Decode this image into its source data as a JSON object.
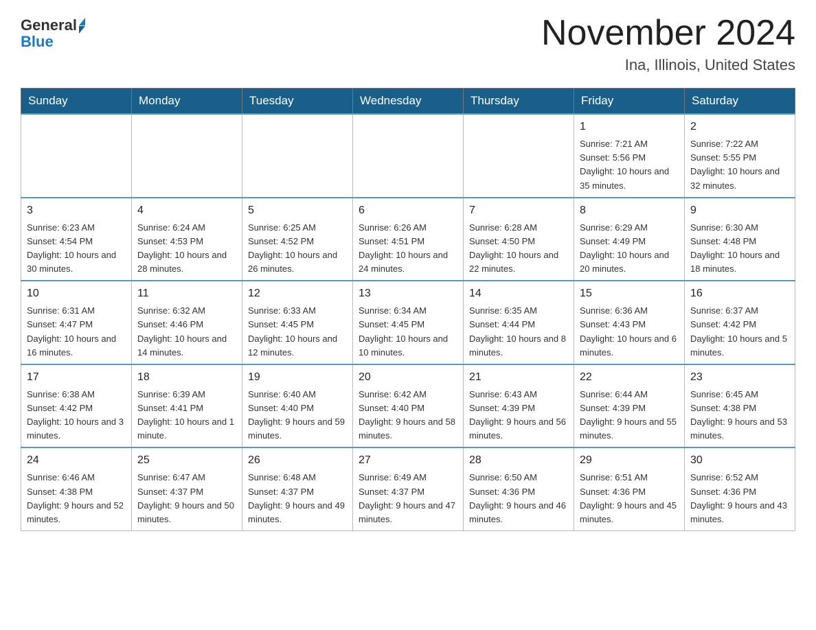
{
  "logo": {
    "general": "General",
    "blue": "Blue"
  },
  "title": "November 2024",
  "location": "Ina, Illinois, United States",
  "weekdays": [
    "Sunday",
    "Monday",
    "Tuesday",
    "Wednesday",
    "Thursday",
    "Friday",
    "Saturday"
  ],
  "weeks": [
    [
      {
        "day": "",
        "info": ""
      },
      {
        "day": "",
        "info": ""
      },
      {
        "day": "",
        "info": ""
      },
      {
        "day": "",
        "info": ""
      },
      {
        "day": "",
        "info": ""
      },
      {
        "day": "1",
        "info": "Sunrise: 7:21 AM\nSunset: 5:56 PM\nDaylight: 10 hours and 35 minutes."
      },
      {
        "day": "2",
        "info": "Sunrise: 7:22 AM\nSunset: 5:55 PM\nDaylight: 10 hours and 32 minutes."
      }
    ],
    [
      {
        "day": "3",
        "info": "Sunrise: 6:23 AM\nSunset: 4:54 PM\nDaylight: 10 hours and 30 minutes."
      },
      {
        "day": "4",
        "info": "Sunrise: 6:24 AM\nSunset: 4:53 PM\nDaylight: 10 hours and 28 minutes."
      },
      {
        "day": "5",
        "info": "Sunrise: 6:25 AM\nSunset: 4:52 PM\nDaylight: 10 hours and 26 minutes."
      },
      {
        "day": "6",
        "info": "Sunrise: 6:26 AM\nSunset: 4:51 PM\nDaylight: 10 hours and 24 minutes."
      },
      {
        "day": "7",
        "info": "Sunrise: 6:28 AM\nSunset: 4:50 PM\nDaylight: 10 hours and 22 minutes."
      },
      {
        "day": "8",
        "info": "Sunrise: 6:29 AM\nSunset: 4:49 PM\nDaylight: 10 hours and 20 minutes."
      },
      {
        "day": "9",
        "info": "Sunrise: 6:30 AM\nSunset: 4:48 PM\nDaylight: 10 hours and 18 minutes."
      }
    ],
    [
      {
        "day": "10",
        "info": "Sunrise: 6:31 AM\nSunset: 4:47 PM\nDaylight: 10 hours and 16 minutes."
      },
      {
        "day": "11",
        "info": "Sunrise: 6:32 AM\nSunset: 4:46 PM\nDaylight: 10 hours and 14 minutes."
      },
      {
        "day": "12",
        "info": "Sunrise: 6:33 AM\nSunset: 4:45 PM\nDaylight: 10 hours and 12 minutes."
      },
      {
        "day": "13",
        "info": "Sunrise: 6:34 AM\nSunset: 4:45 PM\nDaylight: 10 hours and 10 minutes."
      },
      {
        "day": "14",
        "info": "Sunrise: 6:35 AM\nSunset: 4:44 PM\nDaylight: 10 hours and 8 minutes."
      },
      {
        "day": "15",
        "info": "Sunrise: 6:36 AM\nSunset: 4:43 PM\nDaylight: 10 hours and 6 minutes."
      },
      {
        "day": "16",
        "info": "Sunrise: 6:37 AM\nSunset: 4:42 PM\nDaylight: 10 hours and 5 minutes."
      }
    ],
    [
      {
        "day": "17",
        "info": "Sunrise: 6:38 AM\nSunset: 4:42 PM\nDaylight: 10 hours and 3 minutes."
      },
      {
        "day": "18",
        "info": "Sunrise: 6:39 AM\nSunset: 4:41 PM\nDaylight: 10 hours and 1 minute."
      },
      {
        "day": "19",
        "info": "Sunrise: 6:40 AM\nSunset: 4:40 PM\nDaylight: 9 hours and 59 minutes."
      },
      {
        "day": "20",
        "info": "Sunrise: 6:42 AM\nSunset: 4:40 PM\nDaylight: 9 hours and 58 minutes."
      },
      {
        "day": "21",
        "info": "Sunrise: 6:43 AM\nSunset: 4:39 PM\nDaylight: 9 hours and 56 minutes."
      },
      {
        "day": "22",
        "info": "Sunrise: 6:44 AM\nSunset: 4:39 PM\nDaylight: 9 hours and 55 minutes."
      },
      {
        "day": "23",
        "info": "Sunrise: 6:45 AM\nSunset: 4:38 PM\nDaylight: 9 hours and 53 minutes."
      }
    ],
    [
      {
        "day": "24",
        "info": "Sunrise: 6:46 AM\nSunset: 4:38 PM\nDaylight: 9 hours and 52 minutes."
      },
      {
        "day": "25",
        "info": "Sunrise: 6:47 AM\nSunset: 4:37 PM\nDaylight: 9 hours and 50 minutes."
      },
      {
        "day": "26",
        "info": "Sunrise: 6:48 AM\nSunset: 4:37 PM\nDaylight: 9 hours and 49 minutes."
      },
      {
        "day": "27",
        "info": "Sunrise: 6:49 AM\nSunset: 4:37 PM\nDaylight: 9 hours and 47 minutes."
      },
      {
        "day": "28",
        "info": "Sunrise: 6:50 AM\nSunset: 4:36 PM\nDaylight: 9 hours and 46 minutes."
      },
      {
        "day": "29",
        "info": "Sunrise: 6:51 AM\nSunset: 4:36 PM\nDaylight: 9 hours and 45 minutes."
      },
      {
        "day": "30",
        "info": "Sunrise: 6:52 AM\nSunset: 4:36 PM\nDaylight: 9 hours and 43 minutes."
      }
    ]
  ]
}
